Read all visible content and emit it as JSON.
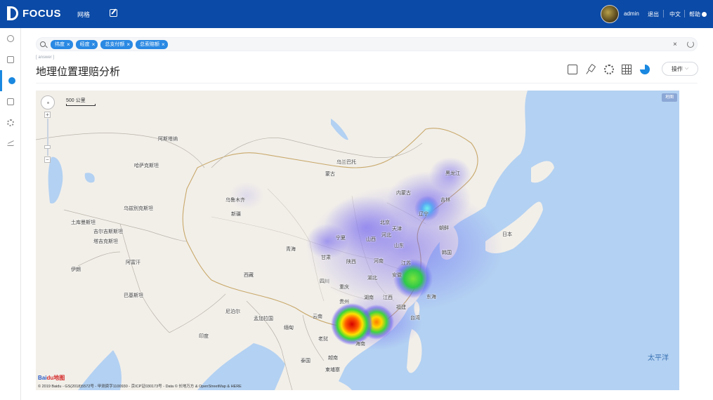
{
  "header": {
    "logo_text": "FOCUS",
    "nav_grid": "网格",
    "username": "admin",
    "logout": "退出",
    "language": "中文",
    "help": "帮助"
  },
  "sidebar": {
    "items": [
      {
        "icon": "search-icon"
      },
      {
        "icon": "pin-board-icon"
      },
      {
        "icon": "help-icon",
        "active": true
      },
      {
        "icon": "database-icon"
      },
      {
        "icon": "gear-icon"
      },
      {
        "icon": "line-chart-icon"
      }
    ]
  },
  "search": {
    "chips": [
      "纬度",
      "经度",
      "总支付额",
      "总索赔额"
    ],
    "chip_close": "×",
    "clear": "×"
  },
  "page": {
    "ghost_tag": "[ answer ]",
    "title": "地理位置理赔分析",
    "ops_button": "操作"
  },
  "map": {
    "map_type": "地图",
    "scale": "500 公里",
    "baidu_logo_a": "Bai",
    "baidu_logo_b": "du地图",
    "copyright": "© 2019 Baidu - GS(2018)5572号 - 甲测资字1100930 - 京ICP证030173号 - Data © 长地万方 & OpenStreetMap & HERE",
    "ocean_label": "太平洋",
    "labels": [
      {
        "text": "哈萨克斯坦",
        "key": "kz"
      },
      {
        "text": "蒙古",
        "key": "mn"
      },
      {
        "text": "乌兹别克斯坦",
        "key": "uz"
      },
      {
        "text": "土库曼斯坦",
        "key": "tm"
      },
      {
        "text": "吉尔吉斯斯坦",
        "key": "kg"
      },
      {
        "text": "塔吉克斯坦",
        "key": "tj"
      },
      {
        "text": "阿富汗",
        "key": "af"
      },
      {
        "text": "伊朗",
        "key": "ir"
      },
      {
        "text": "巴基斯坦",
        "key": "pk"
      },
      {
        "text": "印度",
        "key": "in"
      },
      {
        "text": "尼泊尔",
        "key": "np"
      },
      {
        "text": "孟加拉国",
        "key": "bd"
      },
      {
        "text": "缅甸",
        "key": "mm"
      },
      {
        "text": "老挝",
        "key": "la"
      },
      {
        "text": "泰国",
        "key": "th"
      },
      {
        "text": "越南",
        "key": "vn"
      },
      {
        "text": "柬埔寨",
        "key": "kh"
      },
      {
        "text": "新疆",
        "key": "xj"
      },
      {
        "text": "西藏",
        "key": "xz"
      },
      {
        "text": "青海",
        "key": "qh"
      },
      {
        "text": "甘肃",
        "key": "gs"
      },
      {
        "text": "宁夏",
        "key": "nx"
      },
      {
        "text": "内蒙古",
        "key": "nmg"
      },
      {
        "text": "黑龙江",
        "key": "hlj"
      },
      {
        "text": "吉林",
        "key": "jl"
      },
      {
        "text": "辽宁",
        "key": "ln"
      },
      {
        "text": "北京",
        "key": "bj"
      },
      {
        "text": "天津",
        "key": "tj2"
      },
      {
        "text": "河北",
        "key": "hb"
      },
      {
        "text": "山西",
        "key": "sx"
      },
      {
        "text": "陕西",
        "key": "sn"
      },
      {
        "text": "山东",
        "key": "sd"
      },
      {
        "text": "河南",
        "key": "hn"
      },
      {
        "text": "江苏",
        "key": "js"
      },
      {
        "text": "安徽",
        "key": "ah"
      },
      {
        "text": "湖北",
        "key": "hub"
      },
      {
        "text": "四川",
        "key": "sc"
      },
      {
        "text": "重庆",
        "key": "cq"
      },
      {
        "text": "贵州",
        "key": "gz"
      },
      {
        "text": "湖南",
        "key": "hun"
      },
      {
        "text": "江西",
        "key": "jx"
      },
      {
        "text": "福建",
        "key": "fj"
      },
      {
        "text": "台湾",
        "key": "tw"
      },
      {
        "text": "云南",
        "key": "yn"
      },
      {
        "text": "海南",
        "key": "hi"
      },
      {
        "text": "朝鲜",
        "key": "kp"
      },
      {
        "text": "韩国",
        "key": "kr"
      },
      {
        "text": "日本",
        "key": "jp"
      },
      {
        "text": "乌兰巴托",
        "key": "ub"
      },
      {
        "text": "阿斯塔纳",
        "key": "ast"
      },
      {
        "text": "乌鲁木齐",
        "key": "uq"
      },
      {
        "text": "东海",
        "key": "eh"
      }
    ]
  },
  "colors": {
    "topbar": "#0b4aa6",
    "chip": "#2a89e3",
    "accent": "#1a88e0",
    "ocean": "#b3d1f2",
    "land": "#f2efe9"
  }
}
